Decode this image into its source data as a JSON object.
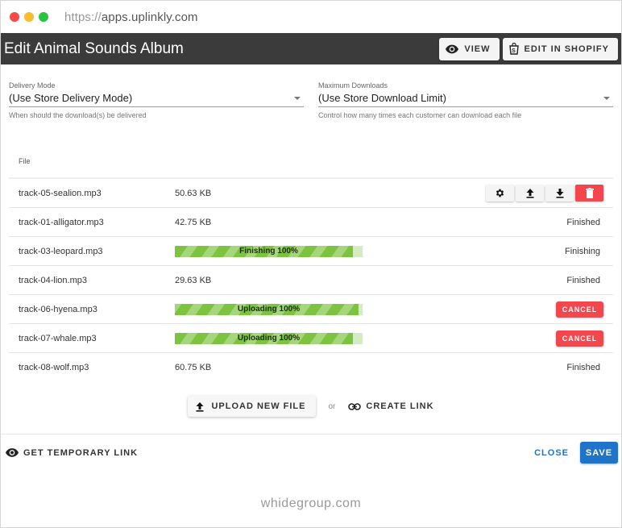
{
  "browser": {
    "url_scheme": "https://",
    "url_host": "apps.uplinkly.com"
  },
  "header": {
    "title": "Edit Animal Sounds Album",
    "view_label": "VIEW",
    "edit_shopify_label": "EDIT IN SHOPIFY"
  },
  "form": {
    "delivery_mode": {
      "label": "Delivery Mode",
      "value": "(Use Store Delivery Mode)",
      "hint": "When should the download(s) be delivered"
    },
    "max_downloads": {
      "label": "Maximum Downloads",
      "value": "(Use Store Download Limit)",
      "hint": "Control how many times each customer can download each file"
    }
  },
  "table": {
    "column_file": "File",
    "rows": [
      {
        "name": "track-05-sealion.mp3",
        "size": "50.63 KB",
        "status": "",
        "actions": [
          "gear-icon",
          "upload-icon",
          "download-icon",
          "trash-icon"
        ]
      },
      {
        "name": "track-01-alligator.mp3",
        "size": "42.75 KB",
        "status": "Finished"
      },
      {
        "name": "track-03-leopard.mp3",
        "progress_label": "Finishing 100%",
        "progress_fraction": 0.95,
        "status": "Finishing"
      },
      {
        "name": "track-04-lion.mp3",
        "size": "29.63 KB",
        "status": "Finished"
      },
      {
        "name": "track-06-hyena.mp3",
        "progress_label": "Uploading 100%",
        "progress_fraction": 0.98,
        "status": "",
        "cancel_label": "CANCEL"
      },
      {
        "name": "track-07-whale.mp3",
        "progress_label": "Uploading 100%",
        "progress_fraction": 0.95,
        "status": "",
        "cancel_label": "CANCEL"
      },
      {
        "name": "track-08-wolf.mp3",
        "size": "60.75 KB",
        "status": "Finished"
      }
    ]
  },
  "upload": {
    "upload_label": "UPLOAD NEW FILE",
    "or_label": "or",
    "create_link_label": "CREATE LINK"
  },
  "footer": {
    "temp_link_label": "GET TEMPORARY LINK",
    "close_label": "CLOSE",
    "save_label": "SAVE"
  },
  "watermark": "whidegroup.com",
  "colors": {
    "header_bg": "#3b3b3b",
    "danger": "#f4474d",
    "primary": "#1f73c8",
    "progress": "#7cc33f"
  }
}
